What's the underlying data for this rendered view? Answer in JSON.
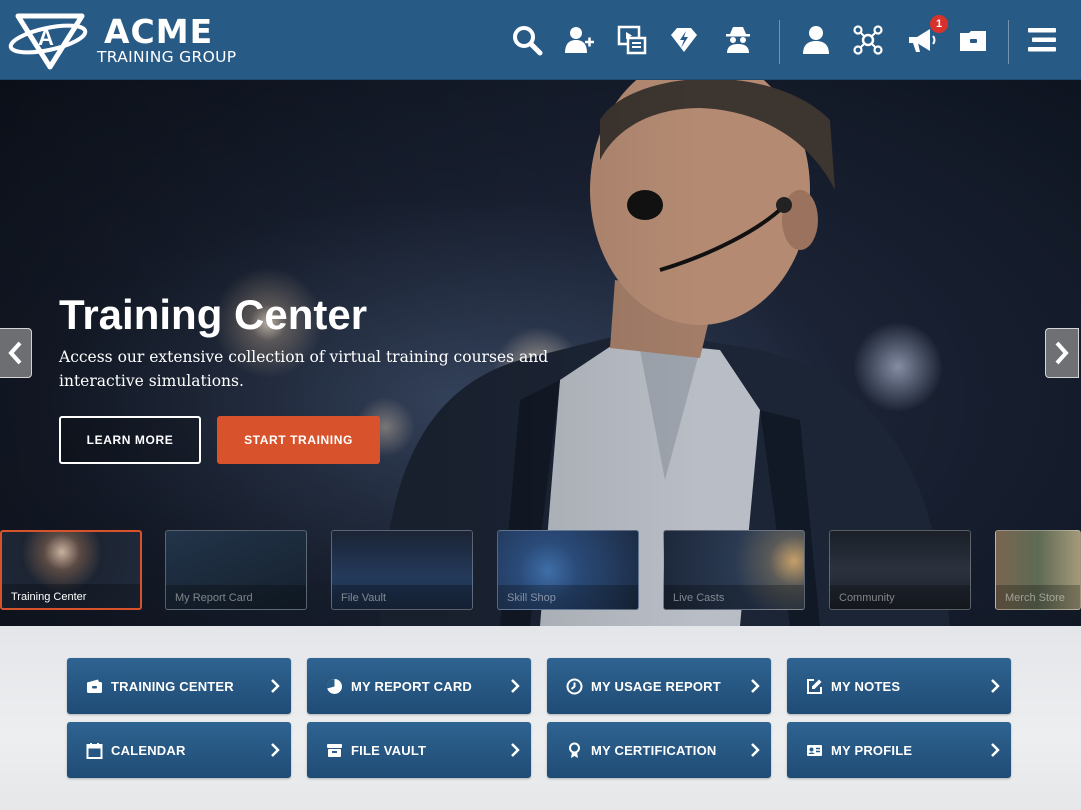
{
  "header": {
    "brand_name": "ACME",
    "brand_sub": "TRAINING GROUP",
    "icons": [
      "search-icon",
      "add-user-icon",
      "media-library-icon",
      "diamond-bolt-icon",
      "spy-icon",
      "user-icon",
      "network-icon",
      "megaphone-icon",
      "folder-icon",
      "hamburger-menu-icon"
    ],
    "notification_count": "1"
  },
  "hero": {
    "title": "Training Center",
    "description": "Access our extensive collection of virtual training courses and interactive simulations.",
    "learn_more": "LEARN MORE",
    "start_training": "START TRAINING"
  },
  "thumbnails": [
    {
      "label": "Training Center",
      "active": true
    },
    {
      "label": "My Report Card",
      "active": false
    },
    {
      "label": "File Vault",
      "active": false
    },
    {
      "label": "Skill Shop",
      "active": false
    },
    {
      "label": "Live Casts",
      "active": false
    },
    {
      "label": "Community",
      "active": false
    },
    {
      "label": "Merch Store",
      "active": false
    }
  ],
  "quick_links": [
    {
      "label": "TRAINING CENTER",
      "icon": "wallet-icon"
    },
    {
      "label": "MY REPORT CARD",
      "icon": "pie-chart-icon"
    },
    {
      "label": "MY USAGE REPORT",
      "icon": "clock-icon"
    },
    {
      "label": "MY NOTES",
      "icon": "edit-icon"
    },
    {
      "label": "CALENDAR",
      "icon": "calendar-icon"
    },
    {
      "label": "FILE VAULT",
      "icon": "archive-icon"
    },
    {
      "label": "MY CERTIFICATION",
      "icon": "award-icon"
    },
    {
      "label": "MY PROFILE",
      "icon": "id-card-icon"
    }
  ],
  "colors": {
    "header": "#285a86",
    "accent": "#d8532c",
    "button": "#2a5c89",
    "badge": "#d8322a"
  }
}
